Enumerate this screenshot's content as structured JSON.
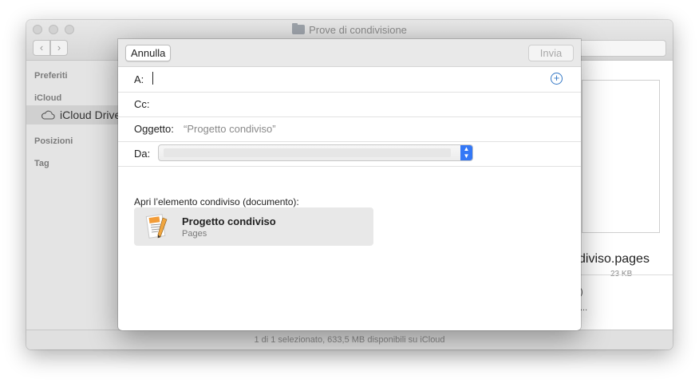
{
  "finder": {
    "window_title": "Prove di condivisione",
    "sidebar": {
      "headings": [
        "Preferiti",
        "iCloud",
        "Posizioni",
        "Tag"
      ],
      "selected_item": "iCloud Drive"
    },
    "preview": {
      "file_name": "diviso.pages",
      "file_size": "23 KB",
      "info_line_1": ")",
      "info_line_2": "..."
    },
    "status_bar": "1 di 1 selezionato, 633,5 MB disponibili su iCloud"
  },
  "sheet": {
    "cancel_label": "Annulla",
    "send_label": "Invia",
    "to_label": "A:",
    "cc_label": "Cc:",
    "subject_label": "Oggetto:",
    "subject_value": "“Progetto condiviso”",
    "from_label": "Da:",
    "from_value": "",
    "open_shared_label": "Apri l’elemento condiviso (documento):",
    "attachment": {
      "title": "Progetto condiviso",
      "app": "Pages",
      "icon": "pages-document-icon"
    },
    "accent_color": "#3478f6"
  }
}
